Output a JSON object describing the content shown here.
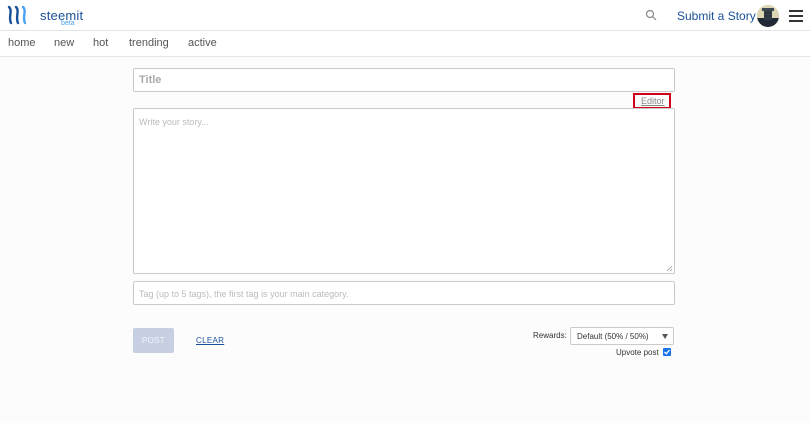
{
  "header": {
    "brand": "steemit",
    "beta": "beta",
    "submit_label": "Submit a Story",
    "icons": {
      "logo": "steemit-logo-icon",
      "search": "search-icon",
      "menu": "hamburger-menu-icon"
    }
  },
  "nav": {
    "items": [
      {
        "label": "home"
      },
      {
        "label": "new"
      },
      {
        "label": "hot"
      },
      {
        "label": "trending"
      },
      {
        "label": "active"
      }
    ]
  },
  "editor": {
    "title_placeholder": "Title",
    "editor_link": "Editor",
    "body_placeholder": "Write your story...",
    "tags_placeholder": "Tag (up to 5 tags), the first tag is your main category."
  },
  "actions": {
    "post_label": "POST",
    "clear_label": "CLEAR",
    "rewards_label": "Rewards:",
    "rewards_value": "Default (50% / 50%)",
    "upvote_label": "Upvote post",
    "upvote_checked": true
  },
  "colors": {
    "brand": "#1a5099",
    "highlight": "#d0021b",
    "post_disabled": "#c6d0e2"
  }
}
